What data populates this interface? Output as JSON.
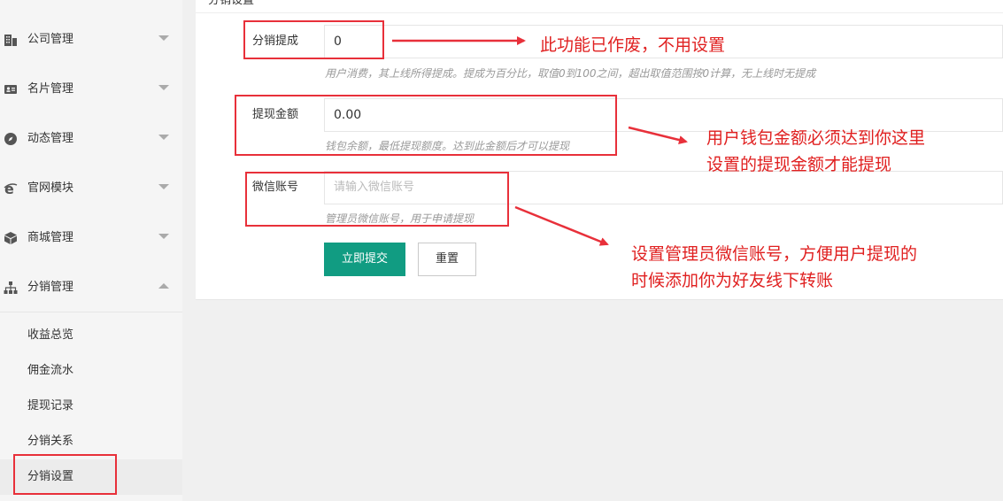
{
  "sidebar": {
    "menus": [
      {
        "label": "公司管理",
        "icon": "building-icon",
        "expanded": false
      },
      {
        "label": "名片管理",
        "icon": "id-card-icon",
        "expanded": false
      },
      {
        "label": "动态管理",
        "icon": "compass-icon",
        "expanded": false
      },
      {
        "label": "官网模块",
        "icon": "ie-globe-icon",
        "expanded": false
      },
      {
        "label": "商城管理",
        "icon": "cube-icon",
        "expanded": false
      },
      {
        "label": "分销管理",
        "icon": "sitemap-icon",
        "expanded": true
      }
    ],
    "submenu": [
      {
        "label": "收益总览"
      },
      {
        "label": "佣金流水"
      },
      {
        "label": "提现记录"
      },
      {
        "label": "分销关系"
      },
      {
        "label": "分销设置",
        "active": true
      }
    ]
  },
  "card": {
    "title": "分销设置"
  },
  "form": {
    "commission": {
      "label": "分销提成",
      "value": "0",
      "help": "用户消费，其上线所得提成。提成为百分比，取值0到100之间，超出取值范围按0计算，无上线时无提成"
    },
    "withdraw": {
      "label": "提现金额",
      "value": "0.00",
      "help": "钱包余额，最低提现额度。达到此金额后才可以提现"
    },
    "wechat": {
      "label": "微信账号",
      "value": "",
      "placeholder": "请输入微信账号",
      "help": "管理员微信账号，用于申请提现"
    },
    "submit_label": "立即提交",
    "reset_label": "重置"
  },
  "annotations": {
    "a1": "此功能已作废，不用设置",
    "a2_line1": "用户钱包金额必须达到你这里",
    "a2_line2": "设置的提现金额才能提现",
    "a3_line1": "设置管理员微信账号，方便用户提现的",
    "a3_line2": "时候添加你为好友线下转账"
  },
  "colors": {
    "primary": "#119c82",
    "annotation_red": "#e8303a"
  }
}
